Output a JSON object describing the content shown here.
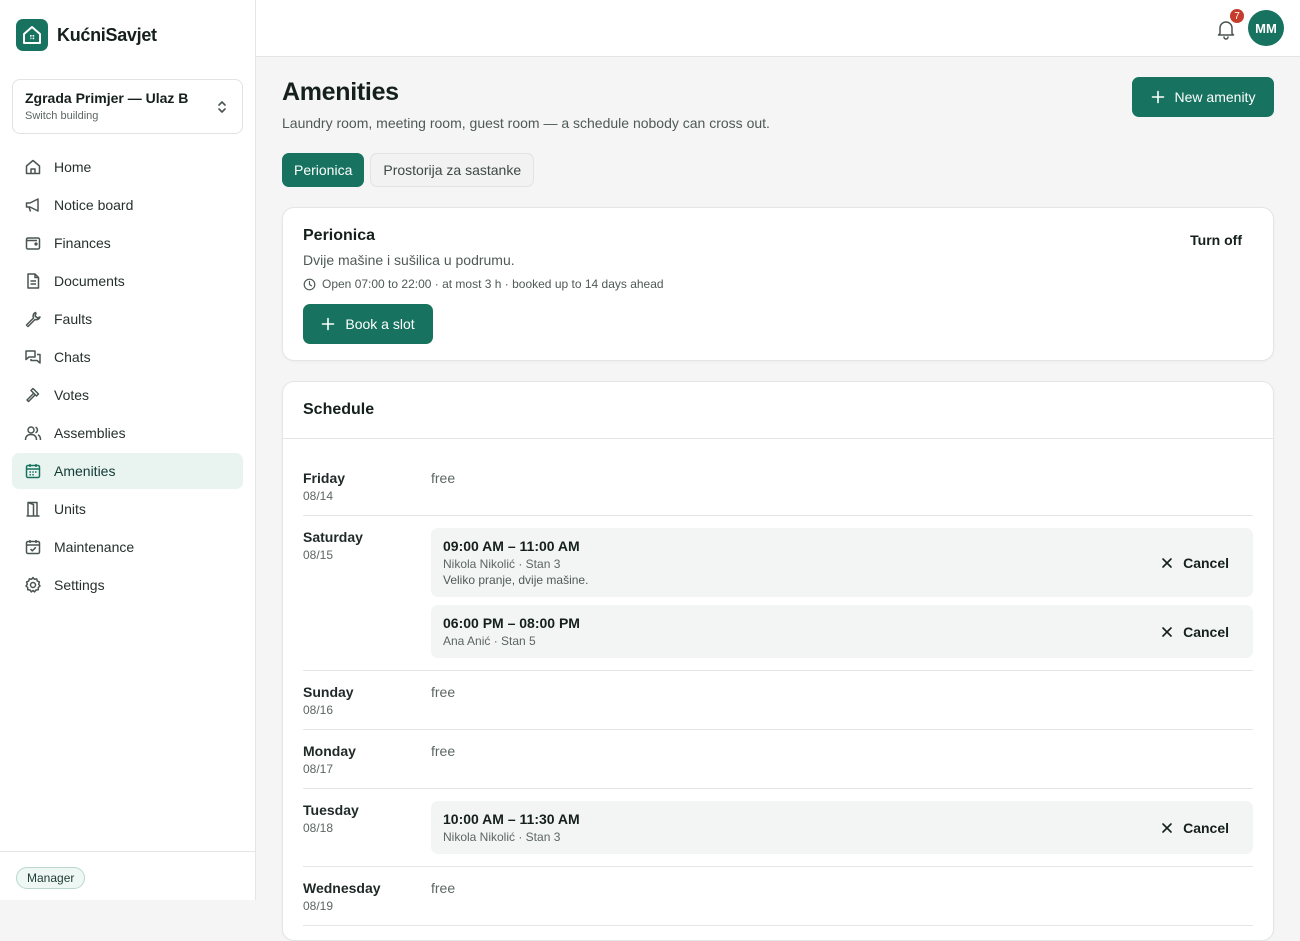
{
  "brand": {
    "name": "KućniSavjet"
  },
  "building": {
    "name": "Zgrada Primjer — Ulaz B",
    "sub": "Switch building"
  },
  "nav": [
    {
      "label": "Home",
      "icon": "home-icon"
    },
    {
      "label": "Notice board",
      "icon": "megaphone-icon"
    },
    {
      "label": "Finances",
      "icon": "wallet-icon"
    },
    {
      "label": "Documents",
      "icon": "document-icon"
    },
    {
      "label": "Faults",
      "icon": "wrench-icon"
    },
    {
      "label": "Chats",
      "icon": "chat-icon"
    },
    {
      "label": "Votes",
      "icon": "gavel-icon"
    },
    {
      "label": "Assemblies",
      "icon": "users-icon"
    },
    {
      "label": "Amenities",
      "icon": "calendar-icon"
    },
    {
      "label": "Units",
      "icon": "door-icon"
    },
    {
      "label": "Maintenance",
      "icon": "calendar-check-icon"
    },
    {
      "label": "Settings",
      "icon": "gear-icon"
    }
  ],
  "footer": {
    "role": "Manager"
  },
  "topbar": {
    "notifications": "7",
    "avatar": "MM"
  },
  "page": {
    "title": "Amenities",
    "subtitle": "Laundry room, meeting room, guest room — a schedule nobody can cross out.",
    "new_button": "New amenity"
  },
  "tabs": [
    {
      "label": "Perionica",
      "active": true
    },
    {
      "label": "Prostorija za sastanke",
      "active": false
    }
  ],
  "amenity": {
    "title": "Perionica",
    "description": "Dvije mašine i sušilica u podrumu.",
    "meta": "Open 07:00 to 22:00 · at most 3 h · booked up to 14 days ahead",
    "turn_off": "Turn off",
    "book_button": "Book a slot"
  },
  "schedule": {
    "title": "Schedule",
    "free_label": "free",
    "cancel_label": "Cancel",
    "days": [
      {
        "name": "Friday",
        "date": "08/14",
        "bookings": []
      },
      {
        "name": "Saturday",
        "date": "08/15",
        "bookings": [
          {
            "time": "09:00 AM – 11:00 AM",
            "who": "Nikola Nikolić · Stan 3",
            "note": "Veliko pranje, dvije mašine."
          },
          {
            "time": "06:00 PM – 08:00 PM",
            "who": "Ana Anić · Stan 5",
            "note": ""
          }
        ]
      },
      {
        "name": "Sunday",
        "date": "08/16",
        "bookings": []
      },
      {
        "name": "Monday",
        "date": "08/17",
        "bookings": []
      },
      {
        "name": "Tuesday",
        "date": "08/18",
        "bookings": [
          {
            "time": "10:00 AM – 11:30 AM",
            "who": "Nikola Nikolić · Stan 3",
            "note": ""
          }
        ]
      },
      {
        "name": "Wednesday",
        "date": "08/19",
        "bookings": []
      }
    ]
  },
  "colors": {
    "accent": "#17735f",
    "badge": "#c53c2c",
    "active_nav_bg": "#e9f4f1"
  }
}
